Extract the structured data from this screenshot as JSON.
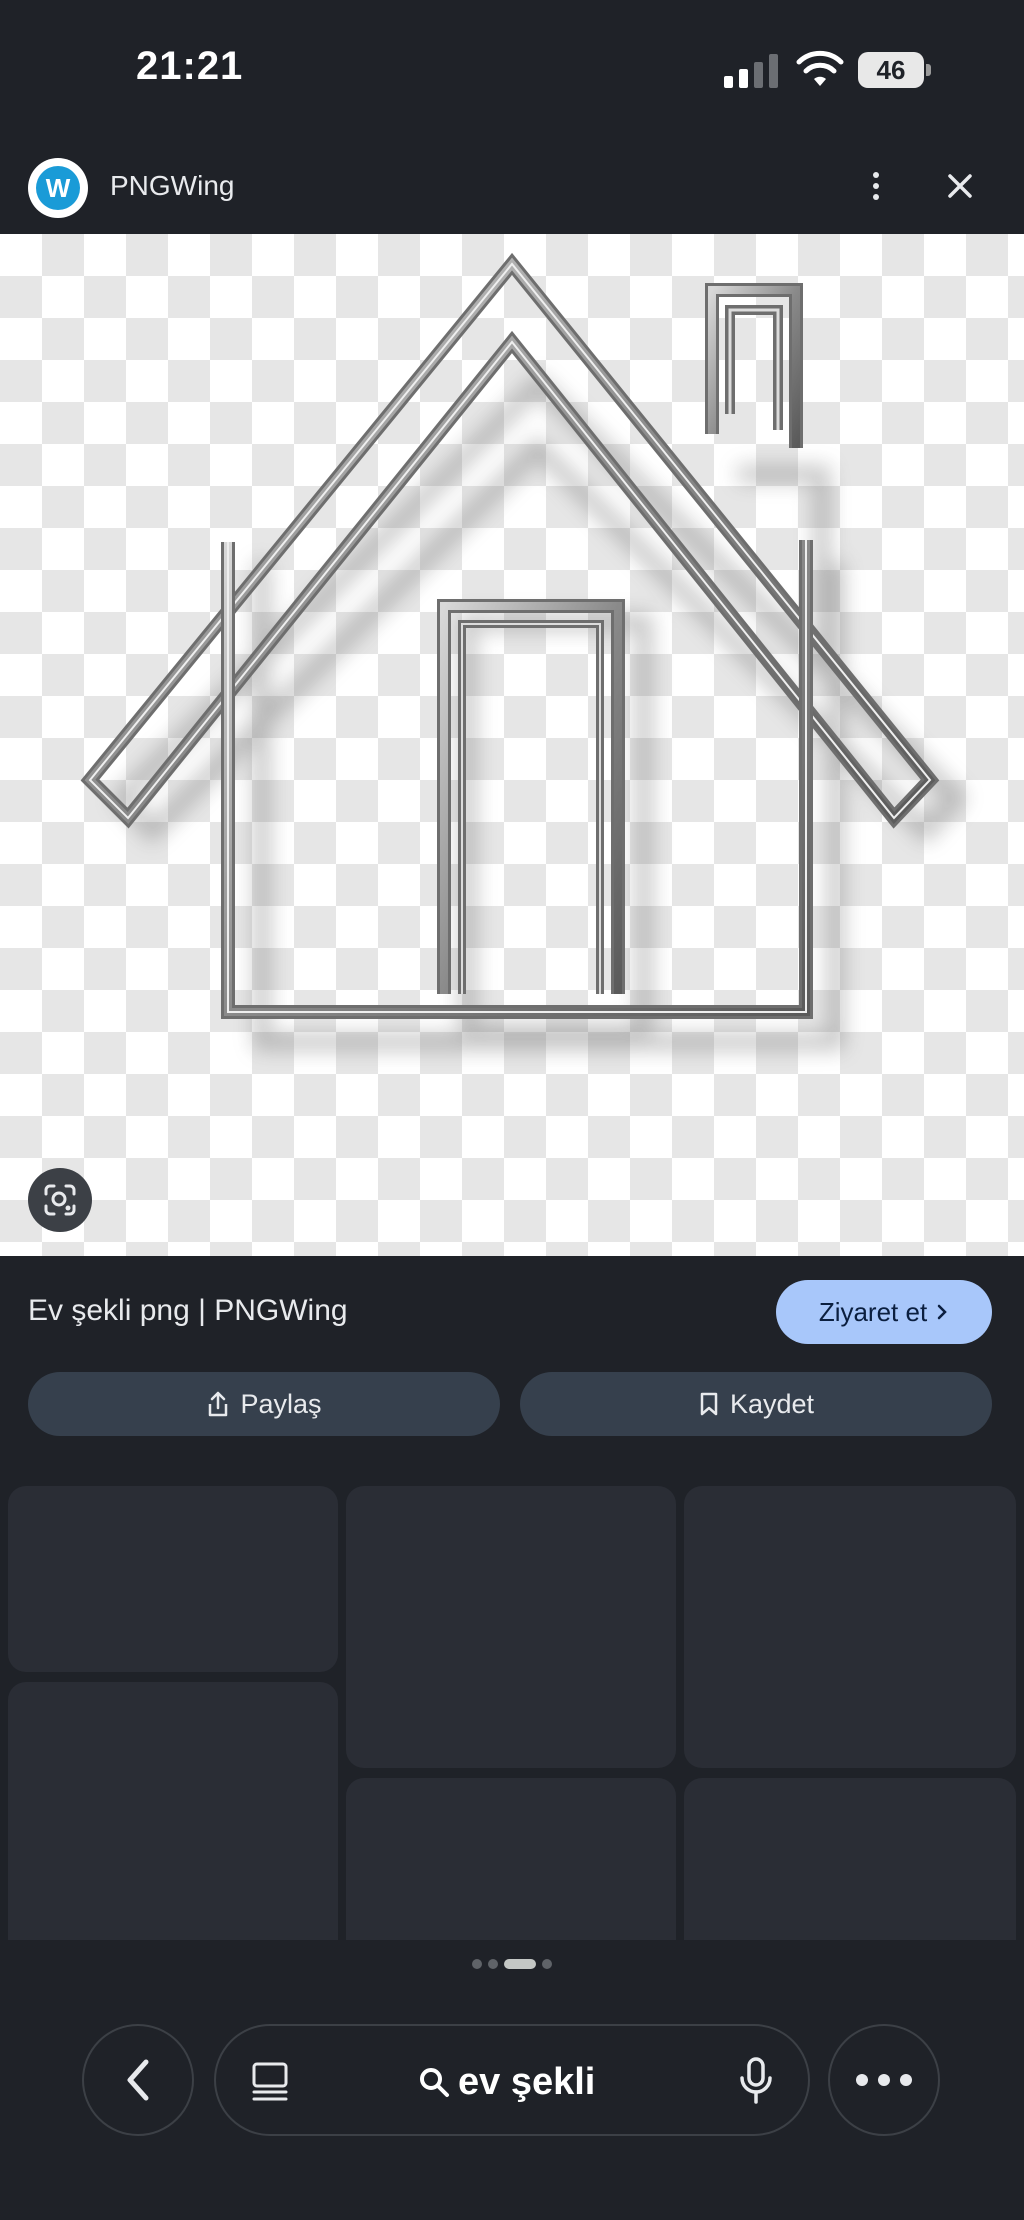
{
  "status_bar": {
    "time": "21:21",
    "battery_level": "46"
  },
  "browser_header": {
    "site_name": "PNGWing",
    "logo_letter": "W"
  },
  "image": {
    "icons": [
      "house-outline",
      "google-lens-icon"
    ]
  },
  "result": {
    "title": "Ev şekli png | PNGWing",
    "visit_label": "Ziyaret et",
    "share_label": "Paylaş",
    "save_label": "Kaydet"
  },
  "pagination": {
    "active_index": 2,
    "count": 4
  },
  "bottom_bar": {
    "search_query": "ev şekli",
    "icons": [
      "back-icon",
      "tabs-icon",
      "search-icon",
      "mic-icon",
      "more-icon"
    ]
  },
  "colors": {
    "background": "#1f2228",
    "accent_button": "#a8c7fa",
    "pill_button": "#36404d",
    "tile": "#2a2d35"
  }
}
